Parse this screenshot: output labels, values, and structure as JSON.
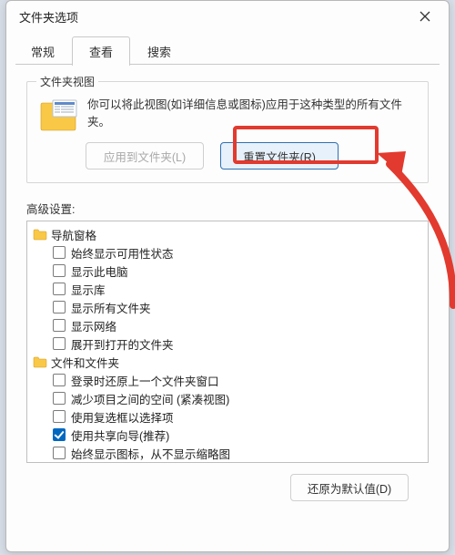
{
  "window": {
    "title": "文件夹选项"
  },
  "tabs": {
    "general": "常规",
    "view": "查看",
    "search": "搜索"
  },
  "folderViews": {
    "legend": "文件夹视图",
    "desc": "你可以将此视图(如详细信息或图标)应用于这种类型的所有文件夹。",
    "applyBtn": "应用到文件夹(L)",
    "resetBtn": "重置文件夹(R)"
  },
  "advanced": {
    "label": "高级设置:",
    "groups": [
      {
        "label": "导航窗格",
        "items": [
          {
            "label": "始终显示可用性状态",
            "checked": false
          },
          {
            "label": "显示此电脑",
            "checked": false
          },
          {
            "label": "显示库",
            "checked": false
          },
          {
            "label": "显示所有文件夹",
            "checked": false
          },
          {
            "label": "显示网络",
            "checked": false
          },
          {
            "label": "展开到打开的文件夹",
            "checked": false
          }
        ]
      },
      {
        "label": "文件和文件夹",
        "items": [
          {
            "label": "登录时还原上一个文件夹窗口",
            "checked": false
          },
          {
            "label": "减少项目之间的空间 (紧凑视图)",
            "checked": false
          },
          {
            "label": "使用复选框以选择项",
            "checked": false
          },
          {
            "label": "使用共享向导(推荐)",
            "checked": true
          },
          {
            "label": "始终显示图标，从不显示缩略图",
            "checked": false
          }
        ]
      }
    ]
  },
  "footer": {
    "restoreDefaults": "还原为默认值(D)"
  }
}
